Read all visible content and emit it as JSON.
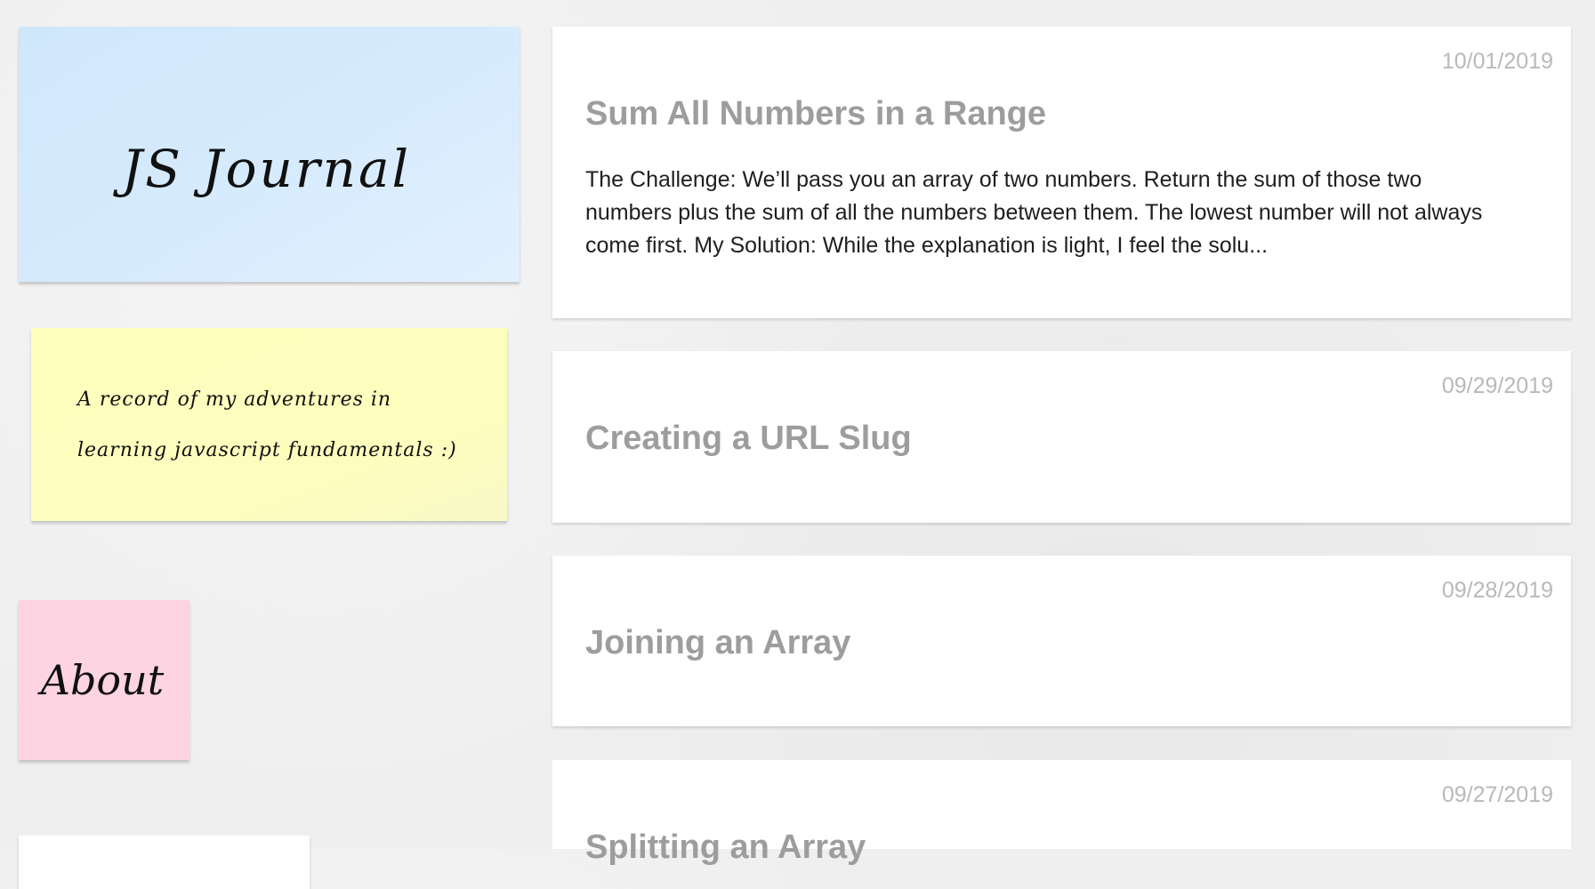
{
  "sidebar": {
    "title_note": {
      "text": "JS Journal",
      "color": "#d4eafd"
    },
    "description_note": {
      "line1": "A record of my adventures in",
      "line2": "learning javascript fundamentals :)",
      "color": "#fefebd"
    },
    "about_note": {
      "label": "About",
      "color": "#fed4e2"
    },
    "extra_note": {
      "color": "#ffffff"
    }
  },
  "posts": [
    {
      "date": "10/01/2019",
      "title": "Sum All Numbers in a Range",
      "excerpt": "The Challenge: We’ll pass you an array of two numbers. Return the sum of those two numbers plus the sum of all the numbers between them. The lowest number will not always come first. My Solution: While the explanation is light, I feel the solu..."
    },
    {
      "date": "09/29/2019",
      "title": "Creating a URL Slug"
    },
    {
      "date": "09/28/2019",
      "title": "Joining an Array"
    },
    {
      "date": "09/27/2019",
      "title": "Splitting an Array"
    }
  ],
  "theme": {
    "background": "#efefef",
    "post_title_color": "#9d9d9d",
    "date_color": "#b9b9b9"
  }
}
